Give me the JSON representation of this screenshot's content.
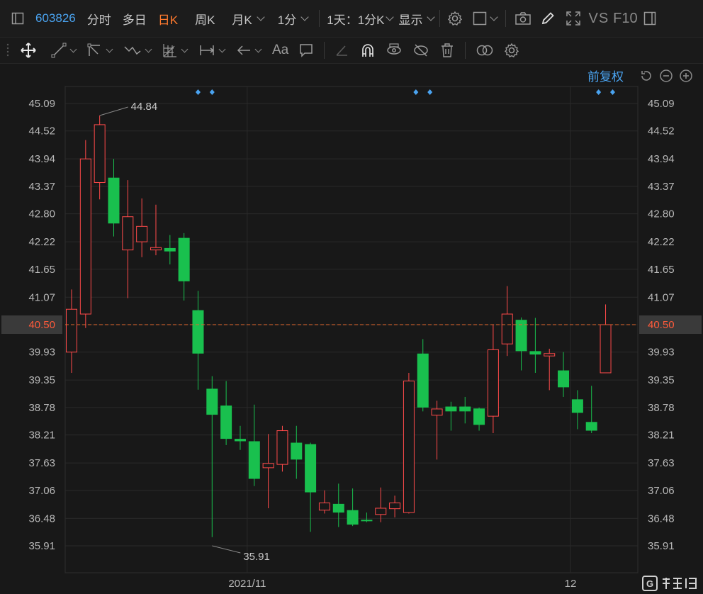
{
  "topbar": {
    "left_icon": "panel-icon",
    "code": "603826",
    "tabs": [
      "分时",
      "多日",
      "日K",
      "周K",
      "月K"
    ],
    "active_tab": "日K",
    "interval": "1分",
    "range": "1天：1分K",
    "display": "显示",
    "vs": "VS",
    "f10": "F10"
  },
  "toolbar": {
    "aa_label": "Aa"
  },
  "controls": {
    "adjust_label": "前复权"
  },
  "chart_data": {
    "type": "candlestick",
    "current_price": 40.5,
    "high_label": "44.84",
    "low_label": "35.91",
    "y_ticks": [
      "45.09",
      "44.52",
      "43.94",
      "43.37",
      "42.80",
      "42.22",
      "41.65",
      "41.07",
      "40.50",
      "39.93",
      "39.35",
      "38.78",
      "38.21",
      "37.63",
      "37.06",
      "36.48",
      "35.91"
    ],
    "ylim": [
      35.91,
      45.09
    ],
    "x_labels": [
      {
        "index": 12.5,
        "label": "2021/11"
      },
      {
        "index": 35.5,
        "label": "12"
      }
    ],
    "marker_pairs": [
      {
        "left": 9.0
      },
      {
        "left": 24.5
      },
      {
        "left": 37.5
      }
    ],
    "candles": [
      {
        "o": 39.93,
        "h": 41.23,
        "l": 39.5,
        "c": 40.82
      },
      {
        "o": 40.72,
        "h": 44.33,
        "l": 40.43,
        "c": 43.94
      },
      {
        "o": 43.45,
        "h": 44.84,
        "l": 43.1,
        "c": 44.65
      },
      {
        "o": 43.55,
        "h": 43.94,
        "l": 42.33,
        "c": 42.6
      },
      {
        "o": 42.05,
        "h": 43.5,
        "l": 41.05,
        "c": 42.74
      },
      {
        "o": 42.22,
        "h": 43.12,
        "l": 41.9,
        "c": 42.54
      },
      {
        "o": 42.05,
        "h": 42.99,
        "l": 41.94,
        "c": 42.1
      },
      {
        "o": 42.09,
        "h": 42.36,
        "l": 41.75,
        "c": 42.02
      },
      {
        "o": 42.3,
        "h": 42.4,
        "l": 41.0,
        "c": 41.4
      },
      {
        "o": 40.8,
        "h": 41.2,
        "l": 39.15,
        "c": 39.9
      },
      {
        "o": 39.17,
        "h": 39.43,
        "l": 36.09,
        "c": 38.63
      },
      {
        "o": 38.82,
        "h": 39.33,
        "l": 38.0,
        "c": 38.13
      },
      {
        "o": 38.13,
        "h": 38.4,
        "l": 37.9,
        "c": 38.08
      },
      {
        "o": 38.08,
        "h": 38.84,
        "l": 37.15,
        "c": 37.3
      },
      {
        "o": 37.53,
        "h": 38.23,
        "l": 36.69,
        "c": 37.62
      },
      {
        "o": 37.6,
        "h": 38.4,
        "l": 37.45,
        "c": 38.3
      },
      {
        "o": 38.05,
        "h": 38.4,
        "l": 37.3,
        "c": 37.7
      },
      {
        "o": 38.02,
        "h": 38.05,
        "l": 36.2,
        "c": 37.02
      },
      {
        "o": 36.65,
        "h": 37.06,
        "l": 36.58,
        "c": 36.8
      },
      {
        "o": 36.78,
        "h": 37.2,
        "l": 36.3,
        "c": 36.6
      },
      {
        "o": 36.65,
        "h": 37.1,
        "l": 36.32,
        "c": 36.35
      },
      {
        "o": 36.45,
        "h": 36.6,
        "l": 36.4,
        "c": 36.42
      },
      {
        "o": 36.56,
        "h": 37.12,
        "l": 36.4,
        "c": 36.69
      },
      {
        "o": 36.68,
        "h": 36.95,
        "l": 36.5,
        "c": 36.8
      },
      {
        "o": 36.6,
        "h": 39.5,
        "l": 36.58,
        "c": 39.33
      },
      {
        "o": 39.9,
        "h": 40.2,
        "l": 38.7,
        "c": 38.78
      },
      {
        "o": 38.62,
        "h": 38.92,
        "l": 37.7,
        "c": 38.75
      },
      {
        "o": 38.8,
        "h": 38.9,
        "l": 38.3,
        "c": 38.7
      },
      {
        "o": 38.8,
        "h": 39.0,
        "l": 38.45,
        "c": 38.7
      },
      {
        "o": 38.76,
        "h": 38.78,
        "l": 38.3,
        "c": 38.42
      },
      {
        "o": 38.6,
        "h": 40.5,
        "l": 38.25,
        "c": 39.98
      },
      {
        "o": 40.1,
        "h": 41.3,
        "l": 39.85,
        "c": 40.72
      },
      {
        "o": 40.6,
        "h": 40.65,
        "l": 39.55,
        "c": 39.95
      },
      {
        "o": 39.95,
        "h": 40.64,
        "l": 39.5,
        "c": 39.88
      },
      {
        "o": 39.85,
        "h": 40.0,
        "l": 39.14,
        "c": 39.9
      },
      {
        "o": 39.55,
        "h": 39.93,
        "l": 39.0,
        "c": 39.2
      },
      {
        "o": 38.95,
        "h": 39.14,
        "l": 38.33,
        "c": 38.67
      },
      {
        "o": 38.48,
        "h": 39.23,
        "l": 38.25,
        "c": 38.3
      },
      {
        "o": 39.5,
        "h": 40.92,
        "l": 39.5,
        "c": 40.5
      }
    ],
    "colors": {
      "up": "#ff4a4a",
      "down": "#19c04e",
      "bg": "#181818",
      "grid": "#2a2a2a",
      "price_line": "#e3692e"
    }
  }
}
